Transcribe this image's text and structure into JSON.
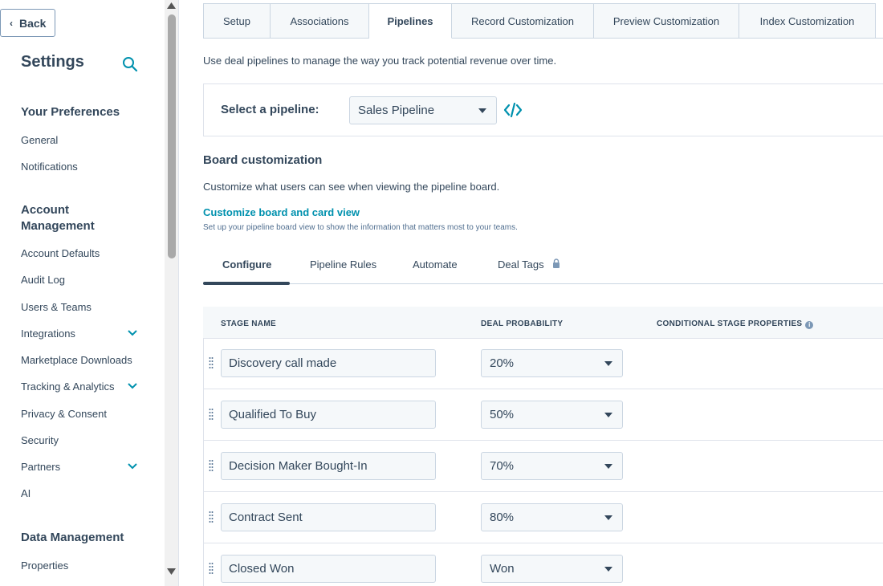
{
  "sidebar": {
    "back_label": "Back",
    "title": "Settings",
    "sections": [
      {
        "heading": "Your Preferences",
        "items": [
          {
            "label": "General",
            "expandable": false
          },
          {
            "label": "Notifications",
            "expandable": false
          }
        ]
      },
      {
        "heading": "Account Management",
        "heading_line1": "Account",
        "heading_line2": "Management",
        "items": [
          {
            "label": "Account Defaults",
            "expandable": false
          },
          {
            "label": "Audit Log",
            "expandable": false
          },
          {
            "label": "Users & Teams",
            "expandable": false
          },
          {
            "label": "Integrations",
            "expandable": true
          },
          {
            "label": "Marketplace Downloads",
            "expandable": false
          },
          {
            "label": "Tracking & Analytics",
            "expandable": true
          },
          {
            "label": "Privacy & Consent",
            "expandable": false
          },
          {
            "label": "Security",
            "expandable": false
          },
          {
            "label": "Partners",
            "expandable": true
          },
          {
            "label": "AI",
            "expandable": false
          }
        ]
      },
      {
        "heading": "Data Management",
        "items": [
          {
            "label": "Properties",
            "expandable": false
          }
        ]
      }
    ]
  },
  "tabs": [
    {
      "label": "Setup",
      "active": false
    },
    {
      "label": "Associations",
      "active": false
    },
    {
      "label": "Pipelines",
      "active": true
    },
    {
      "label": "Record Customization",
      "active": false
    },
    {
      "label": "Preview Customization",
      "active": false
    },
    {
      "label": "Index Customization",
      "active": false
    }
  ],
  "intro_text": "Use deal pipelines to manage the way you track potential revenue over time.",
  "pipeline": {
    "label": "Select a pipeline:",
    "selected": "Sales Pipeline"
  },
  "board": {
    "title": "Board customization",
    "description": "Customize what users can see when viewing the pipeline board.",
    "link_label": "Customize board and card view",
    "link_subtext": "Set up your pipeline board view to show the information that matters most to your teams."
  },
  "subtabs": [
    {
      "label": "Configure",
      "active": true,
      "locked": false
    },
    {
      "label": "Pipeline Rules",
      "active": false,
      "locked": false
    },
    {
      "label": "Automate",
      "active": false,
      "locked": false
    },
    {
      "label": "Deal Tags",
      "active": false,
      "locked": true
    }
  ],
  "table": {
    "columns": [
      "STAGE NAME",
      "DEAL PROBABILITY",
      "CONDITIONAL STAGE PROPERTIES"
    ],
    "rows": [
      {
        "stage": "Discovery call made",
        "probability": "20%"
      },
      {
        "stage": "Qualified To Buy",
        "probability": "50%"
      },
      {
        "stage": "Decision Maker Bought-In",
        "probability": "70%"
      },
      {
        "stage": "Contract Sent",
        "probability": "80%"
      },
      {
        "stage": "Closed Won",
        "probability": "Won"
      }
    ]
  },
  "colors": {
    "text": "#33475b",
    "link": "#0091ae",
    "border": "#cbd6e2",
    "field_bg": "#f5f8fa"
  }
}
